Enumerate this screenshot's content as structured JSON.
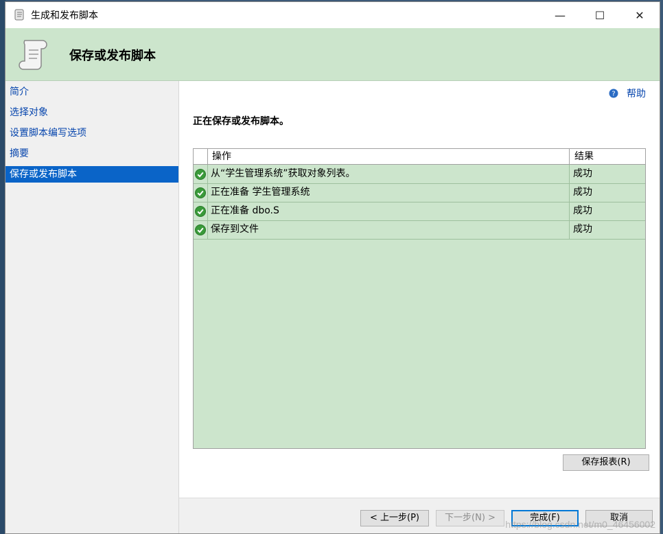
{
  "window": {
    "title": "生成和发布脚本",
    "controls": {
      "minimize": "—",
      "maximize": "☐",
      "close": "✕"
    }
  },
  "banner": {
    "title": "保存或发布脚本"
  },
  "sidebar": {
    "items": [
      {
        "label": "简介",
        "active": false
      },
      {
        "label": "选择对象",
        "active": false
      },
      {
        "label": "设置脚本编写选项",
        "active": false
      },
      {
        "label": "摘要",
        "active": false
      },
      {
        "label": "保存或发布脚本",
        "active": true
      }
    ]
  },
  "content": {
    "help_label": "帮助",
    "heading": "正在保存或发布脚本。",
    "table": {
      "headers": {
        "operation": "操作",
        "result": "结果"
      },
      "rows": [
        {
          "operation": "从“学生管理系统”获取对象列表。",
          "result": "成功",
          "icon": "success-check-icon"
        },
        {
          "operation": "正在准备 学生管理系统",
          "result": "成功",
          "icon": "success-check-icon"
        },
        {
          "operation": "正在准备 dbo.S",
          "result": "成功",
          "icon": "success-check-icon"
        },
        {
          "operation": "保存到文件",
          "result": "成功",
          "icon": "success-check-icon"
        }
      ]
    },
    "save_report_label": "保存报表(R)"
  },
  "footer": {
    "back_label": "< 上一步(P)",
    "next_label": "下一步(N) >",
    "finish_label": "完成(F)",
    "cancel_label": "取消"
  },
  "watermark": "https://blog.csdn.net/m0_46456002",
  "colors": {
    "banner": "#cce5cc",
    "grid": "#cce5cc",
    "active_nav": "#0a64c8",
    "link": "#0645ad"
  }
}
